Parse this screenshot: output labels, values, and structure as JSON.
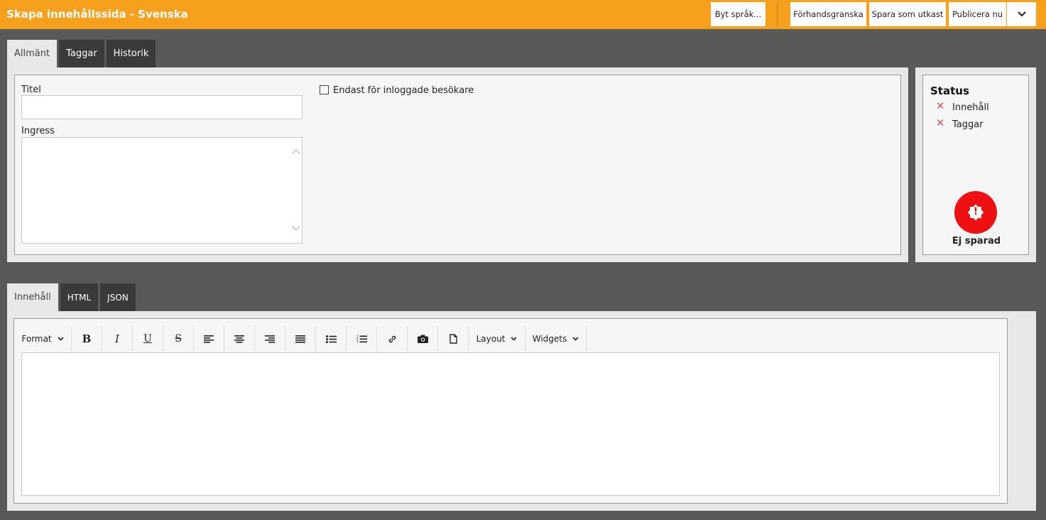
{
  "header": {
    "title": "Skapa innehållssida - Svenska",
    "buttons": {
      "change_language": "Byt språk...",
      "preview": "Förhandsgranska",
      "save_draft": "Spara som utkast",
      "publish": "Publicera nu"
    }
  },
  "top_tabs": [
    {
      "label": "Allmänt"
    },
    {
      "label": "Taggar"
    },
    {
      "label": "Historik"
    }
  ],
  "form": {
    "title_label": "Titel",
    "title_value": "",
    "ingress_label": "Ingress",
    "ingress_value": "",
    "logged_in_only_label": "Endast för inloggade besökare"
  },
  "status": {
    "title": "Status",
    "items": [
      {
        "label": "Innehåll"
      },
      {
        "label": "Taggar"
      }
    ],
    "save_state": "Ej sparad",
    "accent": "#ee1111"
  },
  "editor_tabs": [
    {
      "label": "Innehåll"
    },
    {
      "label": "HTML"
    },
    {
      "label": "JSON"
    }
  ],
  "toolbar": {
    "format": "Format",
    "layout": "Layout",
    "widgets": "Widgets"
  },
  "colors": {
    "brand": "#f6a01e",
    "background": "#595957",
    "tab_dark": "#3a3a3a"
  }
}
